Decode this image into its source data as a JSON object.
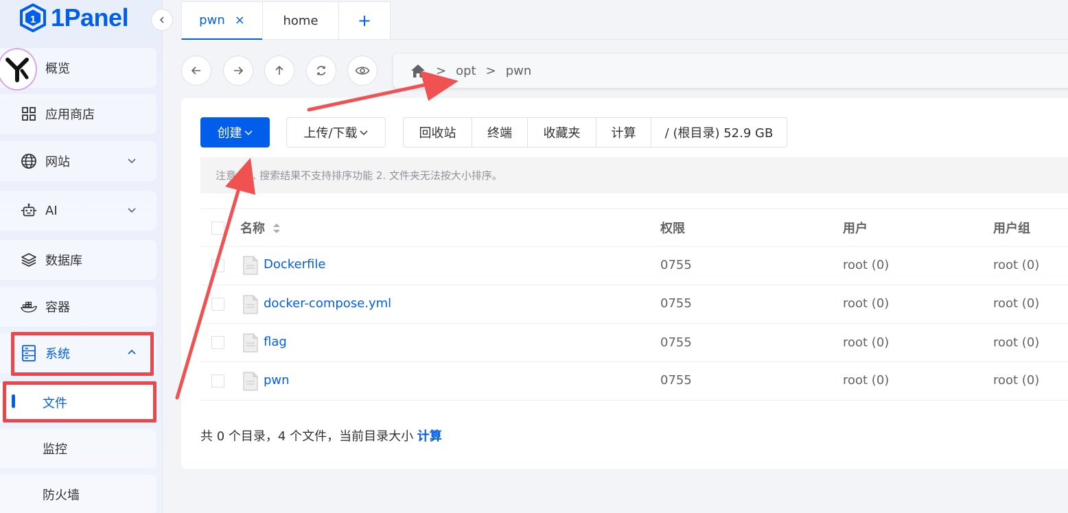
{
  "app": {
    "logo_text": "1Panel"
  },
  "sidebar": {
    "items": [
      {
        "label": "概览"
      },
      {
        "label": "应用商店"
      },
      {
        "label": "网站"
      },
      {
        "label": "AI"
      },
      {
        "label": "数据库"
      },
      {
        "label": "容器"
      },
      {
        "label": "系统"
      }
    ],
    "sub_items": [
      {
        "label": "文件"
      },
      {
        "label": "监控"
      },
      {
        "label": "防火墙"
      }
    ]
  },
  "tabs": [
    {
      "label": "pwn"
    },
    {
      "label": "home"
    },
    {
      "label": "+"
    }
  ],
  "path": {
    "segments": [
      "opt",
      "pwn"
    ],
    "sep": ">"
  },
  "toolbar": {
    "create_label": "创建",
    "upload_label": "上传/下载",
    "group": [
      "回收站",
      "终端",
      "收藏夹",
      "计算",
      "/ (根目录) 52.9 GB"
    ]
  },
  "notice": "注意：1. 搜索结果不支持排序功能 2. 文件夹无法按大小排序。",
  "table": {
    "columns": [
      "名称",
      "权限",
      "用户",
      "用户组"
    ],
    "rows": [
      {
        "name": "Dockerfile",
        "perm": "0755",
        "user": "root (0)",
        "group": "root (0)"
      },
      {
        "name": "docker-compose.yml",
        "perm": "0755",
        "user": "root (0)",
        "group": "root (0)"
      },
      {
        "name": "flag",
        "perm": "0755",
        "user": "root (0)",
        "group": "root (0)"
      },
      {
        "name": "pwn",
        "perm": "0755",
        "user": "root (0)",
        "group": "root (0)"
      }
    ]
  },
  "footer": {
    "summary": "共 0 个目录，4 个文件，当前目录大小 ",
    "link": "计算"
  },
  "colors": {
    "primary": "#005eeb",
    "annotation": "#e8484c"
  }
}
